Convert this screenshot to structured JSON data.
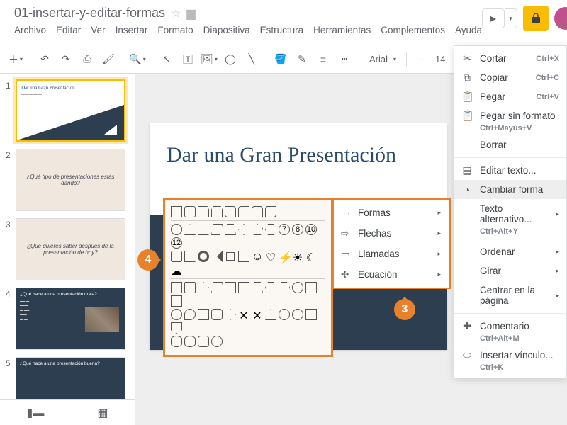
{
  "doc": {
    "title": "01-insertar-y-editar-formas"
  },
  "menu": {
    "file": "Archivo",
    "edit": "Editar",
    "view": "Ver",
    "insert": "Insertar",
    "format": "Formato",
    "slide": "Diapositiva",
    "arrange": "Estructura",
    "tools": "Herramientas",
    "addons": "Complementos",
    "help": "Ayuda"
  },
  "toolbar": {
    "font": "Arial",
    "size": "14"
  },
  "slides": {
    "s1_title": "Dar una Gran Presentación",
    "s2": "¿Qué tipo de presentaciones estás dando?",
    "s3": "¿Qué quieres saber después de la presentación de hoy?",
    "s4": "¿Qué hace a una presentación mala?",
    "s5": "¿Qué hace a una presentación buena?"
  },
  "canvas": {
    "title": "Dar una Gran Presentación"
  },
  "ctx": {
    "cut": "Cortar",
    "cut_k": "Ctrl+X",
    "copy": "Copiar",
    "copy_k": "Ctrl+C",
    "paste": "Pegar",
    "paste_k": "Ctrl+V",
    "paste_nf": "Pegar sin formato",
    "paste_nf_k": "Ctrl+Mayús+V",
    "delete": "Borrar",
    "edit_text": "Editar texto...",
    "change_shape": "Cambiar forma",
    "alt_text": "Texto alternativo...",
    "alt_text_k": "Ctrl+Alt+Y",
    "order": "Ordenar",
    "rotate": "Girar",
    "center": "Centrar en la página",
    "comment": "Comentario",
    "comment_k": "Ctrl+Alt+M",
    "link": "Insertar vínculo...",
    "link_k": "Ctrl+K"
  },
  "submenu": {
    "shapes": "Formas",
    "arrows": "Flechas",
    "callouts": "Llamadas",
    "equation": "Ecuación"
  },
  "callouts": {
    "c3": "3",
    "c4": "4"
  }
}
